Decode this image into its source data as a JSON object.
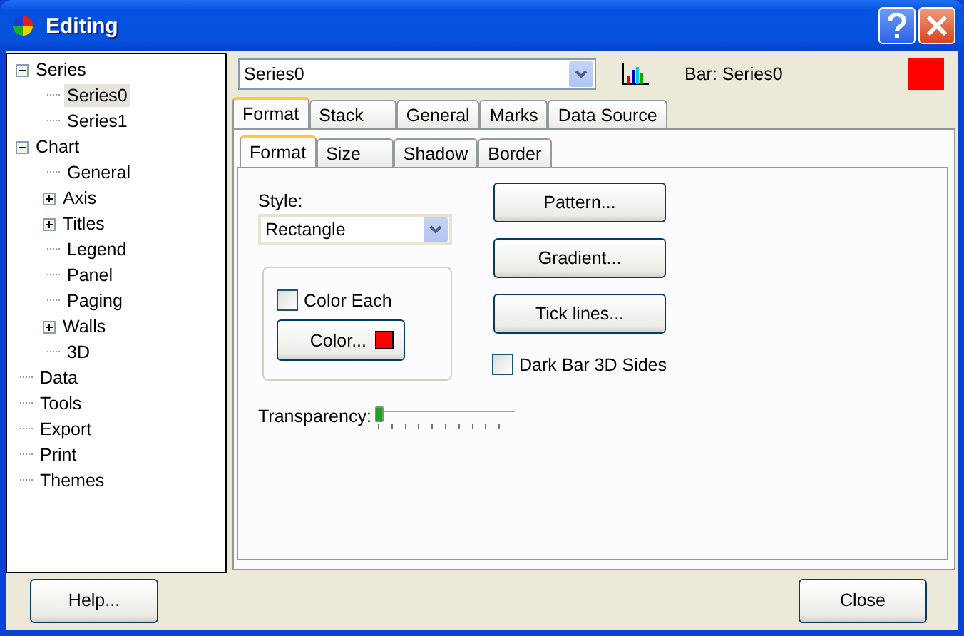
{
  "window": {
    "title": "Editing"
  },
  "tree": [
    {
      "label": "Series",
      "expanded": true,
      "selected": false,
      "children": [
        {
          "label": "Series0",
          "selected": true
        },
        {
          "label": "Series1",
          "selected": false
        }
      ]
    },
    {
      "label": "Chart",
      "expanded": true,
      "selected": false,
      "children": [
        {
          "label": "General",
          "selected": false
        },
        {
          "label": "Axis",
          "expanded": false,
          "selected": false
        },
        {
          "label": "Titles",
          "expanded": false,
          "selected": false
        },
        {
          "label": "Legend",
          "selected": false
        },
        {
          "label": "Panel",
          "selected": false
        },
        {
          "label": "Paging",
          "selected": false
        },
        {
          "label": "Walls",
          "expanded": false,
          "selected": false
        },
        {
          "label": "3D",
          "selected": false
        }
      ]
    },
    {
      "label": "Data",
      "selected": false
    },
    {
      "label": "Tools",
      "selected": false
    },
    {
      "label": "Export",
      "selected": false
    },
    {
      "label": "Print",
      "selected": false
    },
    {
      "label": "Themes",
      "selected": false
    }
  ],
  "series_select": {
    "value": "Series0"
  },
  "series_label": "Bar: Series0",
  "series_swatch": {
    "color": "#ff0000"
  },
  "tabs": [
    {
      "label": "Format",
      "selected": true
    },
    {
      "label": "Stack",
      "selected": false
    },
    {
      "label": "General",
      "selected": false
    },
    {
      "label": "Marks",
      "selected": false
    },
    {
      "label": "Data Source",
      "selected": false
    }
  ],
  "subtabs": [
    {
      "label": "Format",
      "selected": true
    },
    {
      "label": "Size",
      "selected": false
    },
    {
      "label": "Shadow",
      "selected": false
    },
    {
      "label": "Border",
      "selected": false
    }
  ],
  "style": {
    "label": "Style:",
    "value": "Rectangle"
  },
  "color_each": {
    "label": "Color Each",
    "checked": false
  },
  "color_button": {
    "label": "Color...",
    "color": "#ff0000"
  },
  "buttons": [
    "Pattern...",
    "Gradient...",
    "Tick lines..."
  ],
  "dark_bar": {
    "label": "Dark Bar 3D Sides",
    "checked": false
  },
  "transparency": {
    "label": "Transparency:",
    "level": 0
  },
  "footer": [
    "Help...",
    "Close"
  ]
}
